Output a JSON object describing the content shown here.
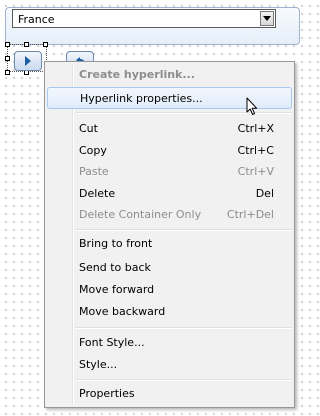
{
  "dropdown": {
    "value": "France",
    "arrow_icon": "triangle-down-icon"
  },
  "nav_buttons": {
    "next_icon": "play-right-icon",
    "prev_icon": "back-arrow-icon"
  },
  "context_menu": {
    "items": [
      {
        "label": "Create hyperlink...",
        "shortcut": "",
        "disabled": true
      },
      {
        "label": "Hyperlink properties...",
        "shortcut": "",
        "disabled": false,
        "hover": true
      },
      {
        "label": "Cut",
        "shortcut": "Ctrl+X",
        "disabled": false
      },
      {
        "label": "Copy",
        "shortcut": "Ctrl+C",
        "disabled": false
      },
      {
        "label": "Paste",
        "shortcut": "Ctrl+V",
        "disabled": true
      },
      {
        "label": "Delete",
        "shortcut": "Del",
        "disabled": false
      },
      {
        "label": "Delete Container Only",
        "shortcut": "Ctrl+Del",
        "disabled": true
      },
      {
        "label": "Bring to front",
        "shortcut": "",
        "disabled": false
      },
      {
        "label": "Send to back",
        "shortcut": "",
        "disabled": false
      },
      {
        "label": "Move forward",
        "shortcut": "",
        "disabled": false
      },
      {
        "label": "Move backward",
        "shortcut": "",
        "disabled": false
      },
      {
        "label": "Font Style...",
        "shortcut": "",
        "disabled": false
      },
      {
        "label": "Style...",
        "shortcut": "",
        "disabled": false
      },
      {
        "label": "Properties",
        "shortcut": "",
        "disabled": false
      }
    ]
  },
  "colors": {
    "menu_background": "#f1f1f1",
    "hover_border": "#a9c8ee",
    "disabled_text": "#8d8d8d",
    "button_blue": "#1f5fa8"
  },
  "cursor_icon": "mouse-pointer-icon"
}
